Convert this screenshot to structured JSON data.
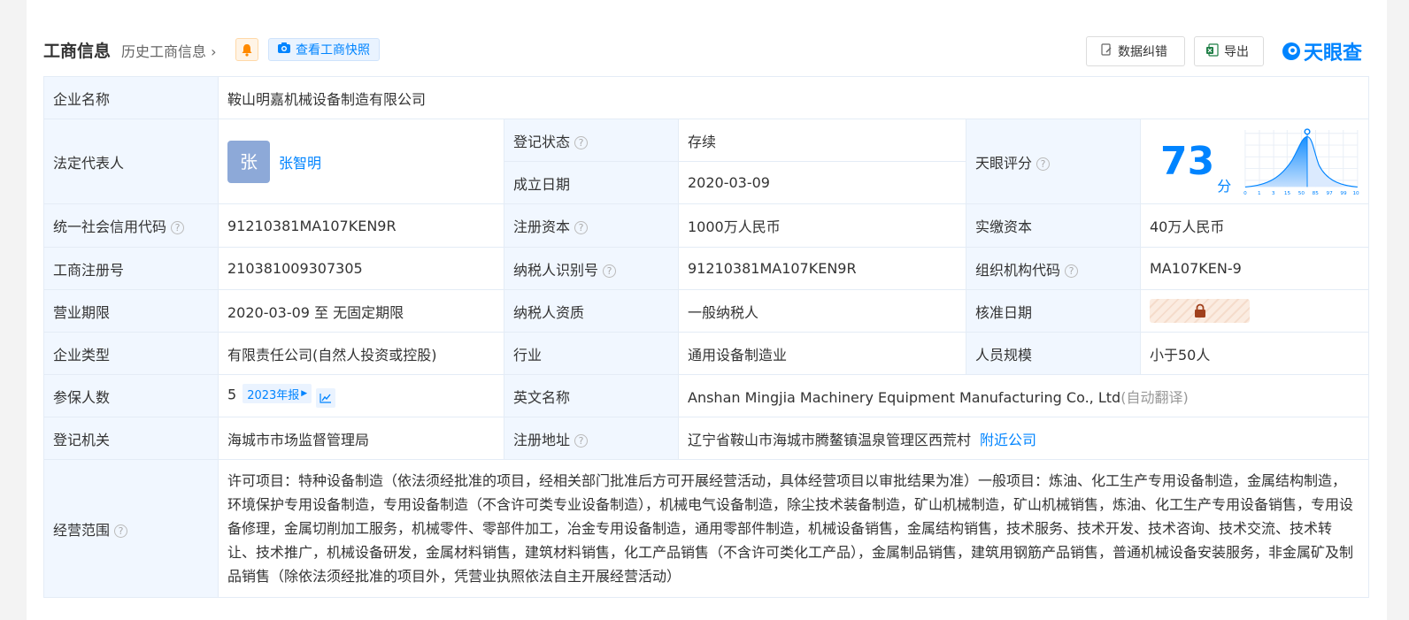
{
  "header": {
    "title": "工商信息",
    "history_link": "历史工商信息",
    "snapshot_label": "查看工商快照",
    "correct_label": "数据纠错",
    "export_label": "导出",
    "brand": "天眼查"
  },
  "company": {
    "name_label": "企业名称",
    "name": "鞍山明嘉机械设备制造有限公司",
    "legal_rep_label": "法定代表人",
    "legal_rep_avatar": "张",
    "legal_rep": "张智明",
    "reg_status_label": "登记状态",
    "reg_status": "存续",
    "found_date_label": "成立日期",
    "found_date": "2020-03-09",
    "score_label": "天眼评分",
    "score": "73",
    "score_unit": "分",
    "score_axis": [
      "0",
      "1",
      "3",
      "15",
      "50",
      "85",
      "97",
      "99",
      "100"
    ],
    "credit_code_label": "统一社会信用代码",
    "credit_code": "91210381MA107KEN9R",
    "reg_capital_label": "注册资本",
    "reg_capital": "1000万人民币",
    "paid_capital_label": "实缴资本",
    "paid_capital": "40万人民币",
    "reg_no_label": "工商注册号",
    "reg_no": "210381009307305",
    "taxpayer_id_label": "纳税人识别号",
    "taxpayer_id": "91210381MA107KEN9R",
    "org_code_label": "组织机构代码",
    "org_code": "MA107KEN-9",
    "term_label": "营业期限",
    "term": "2020-03-09 至 无固定期限",
    "taxpayer_qual_label": "纳税人资质",
    "taxpayer_qual": "一般纳税人",
    "approve_date_label": "核准日期",
    "type_label": "企业类型",
    "type": "有限责任公司(自然人投资或控股)",
    "industry_label": "行业",
    "industry": "通用设备制造业",
    "staff_size_label": "人员规模",
    "staff_size": "小于50人",
    "insured_label": "参保人数",
    "insured": "5",
    "insured_report": "2023年报",
    "english_name_label": "英文名称",
    "english_name": "Anshan Mingjia Machinery Equipment Manufacturing Co., Ltd",
    "auto_translate": "(自动翻译)",
    "authority_label": "登记机关",
    "authority": "海城市市场监督管理局",
    "address_label": "注册地址",
    "address": "辽宁省鞍山市海城市腾鳌镇温泉管理区西荒村",
    "nearby_link": "附近公司",
    "scope_label": "经营范围",
    "scope": "许可项目：特种设备制造（依法须经批准的项目，经相关部门批准后方可开展经营活动，具体经营项目以审批结果为准）一般项目：炼油、化工生产专用设备制造，金属结构制造，环境保护专用设备制造，专用设备制造（不含许可类专业设备制造），机械电气设备制造，除尘技术装备制造，矿山机械制造，矿山机械销售，炼油、化工生产专用设备销售，专用设备修理，金属切削加工服务，机械零件、零部件加工，冶金专用设备制造，通用零部件制造，机械设备销售，金属结构销售，技术服务、技术开发、技术咨询、技术交流、技术转让、技术推广，机械设备研发，金属材料销售，建筑材料销售，化工产品销售（不含许可类化工产品），金属制品销售，建筑用钢筋产品销售，普通机械设备安装服务，非金属矿及制品销售（除依法须经批准的项目外，凭营业执照依法自主开展经营活动）"
  },
  "colors": {
    "accent": "#0084ff",
    "status_green": "#00a85a",
    "label_bg": "#f1f7ff",
    "border": "#e4ecf6"
  }
}
